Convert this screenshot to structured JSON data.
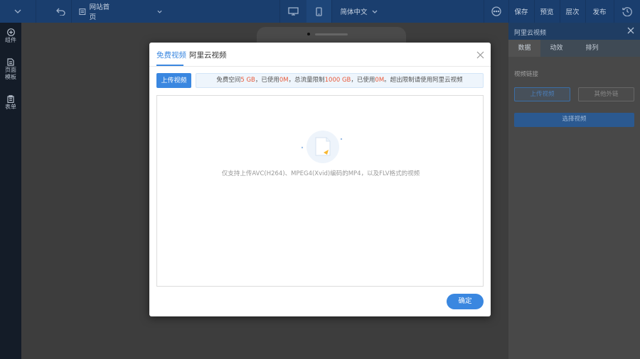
{
  "topbar": {
    "page_select": "网站首页",
    "language_select": "简体中文",
    "actions": {
      "save": "保存",
      "preview": "预览",
      "layers": "层次",
      "publish": "发布"
    }
  },
  "leftbar": {
    "items": [
      {
        "label": "组件",
        "icon": "plus-circle-icon"
      },
      {
        "label_line1": "页面",
        "label_line2": "模板",
        "icon": "page-icon"
      },
      {
        "label": "表单",
        "icon": "clipboard-icon"
      }
    ]
  },
  "right_panel": {
    "title": "阿里云视频",
    "tabs": [
      "数据",
      "动效",
      "排列"
    ],
    "section_label": "视频链接",
    "upload_label": "上传视频",
    "external_label": "其他外链",
    "choose_label": "选择视频"
  },
  "modal": {
    "tabs": [
      "免费视频",
      "阿里云视频"
    ],
    "upload_label": "上传视频",
    "info": {
      "p1": "免费空间",
      "free_space": "5 GB",
      "p2": "，已使用",
      "used_space": "0M",
      "p3": "，总流量限制",
      "traffic_limit": "1000 GB",
      "p4": "，已使用",
      "used_traffic": "0M",
      "p5": "。超出限制请使用阿里云视频"
    },
    "empty_text": "仅支持上传AVC(H264)、MPEG4(Xvid)编码的MP4，以及FLV格式的视频",
    "confirm_label": "确定"
  },
  "colors": {
    "accent": "#3a87e0",
    "highlight": "#e85a3b",
    "topbar": "#1a3e6e"
  }
}
